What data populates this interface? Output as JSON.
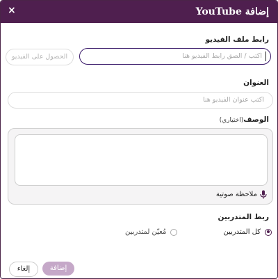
{
  "dialog": {
    "title": "إضافة YouTube",
    "close_label": "×"
  },
  "video_url": {
    "label": "رابط ملف الفيديو",
    "placeholder": "اكتب / الصق رابط الفيديو هنا",
    "fetch_button": "الحصول على الفيديو"
  },
  "title_field": {
    "label": "العنوان",
    "placeholder": "اكتب عنوان الفيديو هنا"
  },
  "description": {
    "label": "الوصف",
    "optional": "(اختياري)",
    "voice_note": "ملاحظة صوتية"
  },
  "trainees": {
    "label": "ربط المتدربين",
    "options": [
      {
        "label": "كل المتدربين",
        "checked": true
      },
      {
        "label": "مُعيّن لمتدربين",
        "checked": false
      }
    ]
  },
  "footer": {
    "add_label": "إضافة",
    "cancel_label": "إلغاء"
  },
  "colors": {
    "header": "#4f1f4f",
    "add_button": "#c5a8c8"
  }
}
